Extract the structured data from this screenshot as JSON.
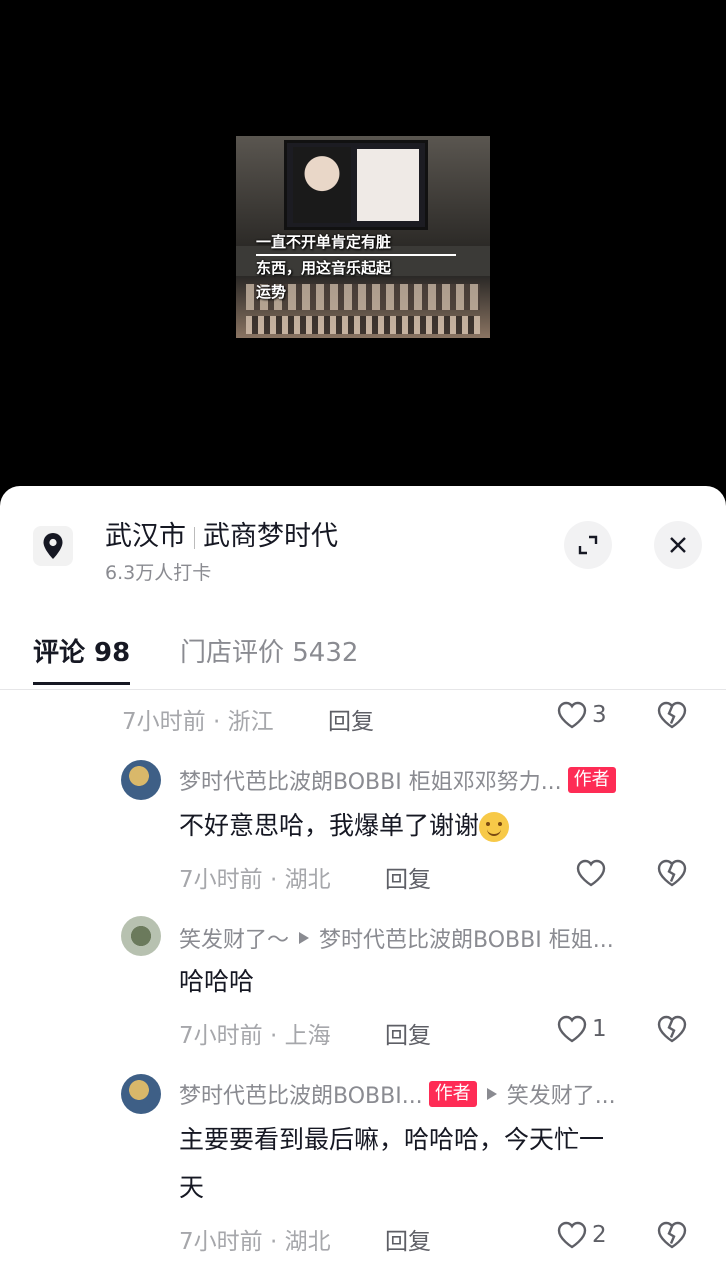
{
  "video": {
    "caption_line1": "一直不开单肯定有脏",
    "caption_line2": "东西，用这音乐起起",
    "caption_line3": "运势"
  },
  "location": {
    "city": "武汉市",
    "place": "武商梦时代",
    "checkins": "6.3万人打卡"
  },
  "tabs": [
    {
      "label": "评论 98",
      "active": true
    },
    {
      "label": "门店评价 5432",
      "active": false
    }
  ],
  "comments": [
    {
      "meta": "7小时前 · 浙江",
      "reply": "回复",
      "likes": "3"
    },
    {
      "name": "梦时代芭比波朗BOBBI 柜姐邓邓努力...",
      "badge": "作者",
      "text": "不好意思哈，我爆单了谢谢",
      "meta": "7小时前 · 湖北",
      "reply": "回复",
      "likes": ""
    },
    {
      "name": "笑发财了～",
      "reply_to": "梦时代芭比波朗BOBBI 柜姐...",
      "text": "哈哈哈",
      "meta": "7小时前 · 上海",
      "reply": "回复",
      "likes": "1"
    },
    {
      "name": "梦时代芭比波朗BOBBI...",
      "badge": "作者",
      "reply_to": "笑发财了...",
      "text_line1": "主要要看到最后嘛，哈哈哈，今天忙一",
      "text_line2": "天",
      "meta": "7小时前 · 湖北",
      "reply": "回复",
      "likes": "2"
    }
  ],
  "icons": [
    "location-pin-icon",
    "expand-icon",
    "close-icon",
    "heart-icon",
    "broken-heart-icon",
    "reply-arrow-icon"
  ],
  "colors": {
    "accent": "#fe2c55",
    "text": "#161823",
    "muted": "#8a8b91"
  }
}
